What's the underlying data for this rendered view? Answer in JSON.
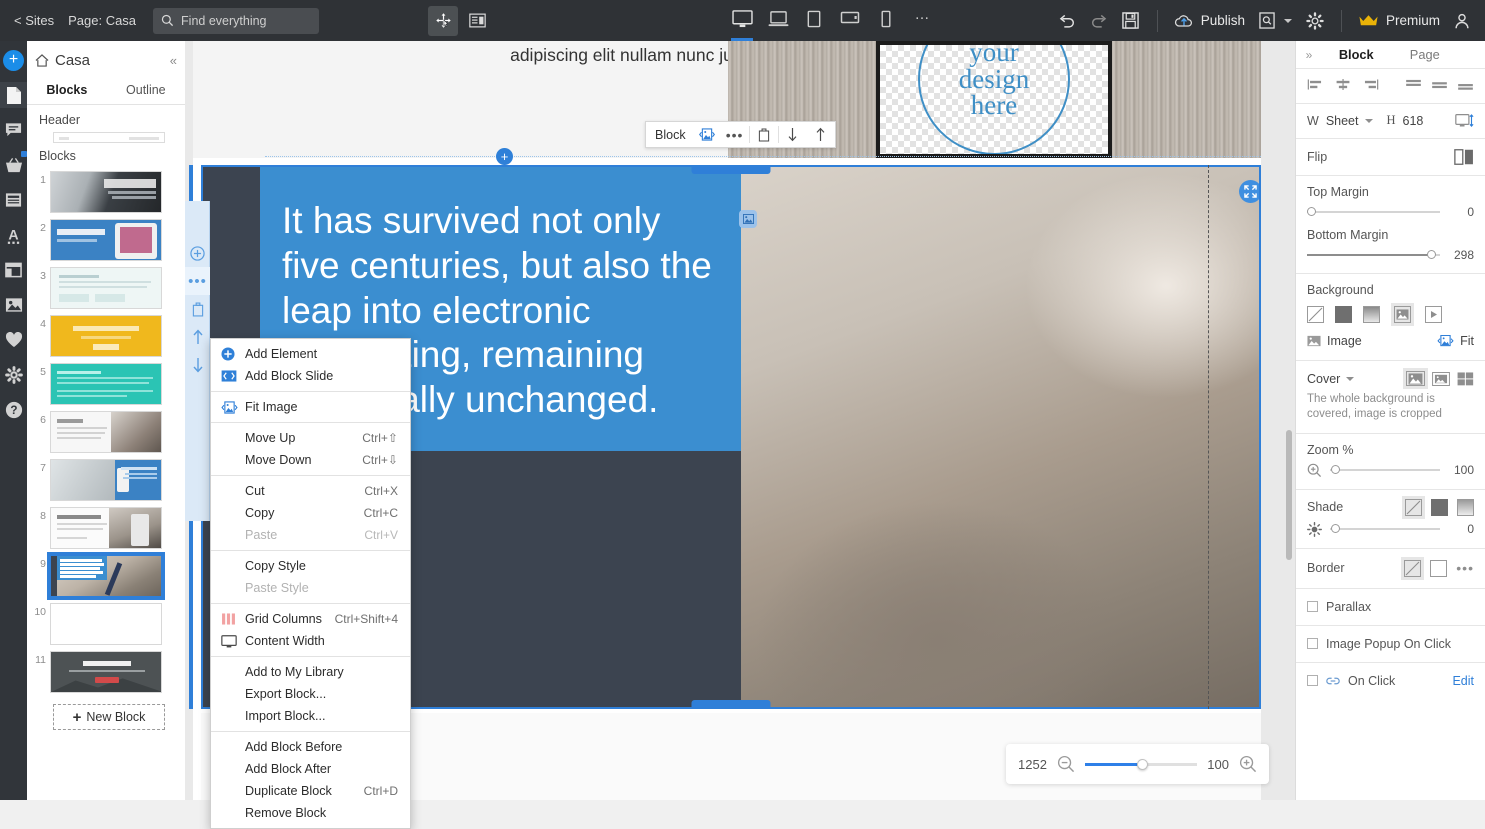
{
  "topbar": {
    "sites_link": "< Sites",
    "page_label": "Page: Casa",
    "search_placeholder": "Find everything",
    "move_tool_icon": "move-tool-icon",
    "layout_tool_icon": "layout-panel-icon",
    "devices": [
      {
        "name": "desktop",
        "selected": true
      },
      {
        "name": "laptop",
        "selected": false
      },
      {
        "name": "tablet-portrait",
        "selected": false
      },
      {
        "name": "tablet-landscape",
        "selected": false
      },
      {
        "name": "mobile",
        "selected": false
      }
    ],
    "more_devices": "…",
    "undo_icon": "undo-icon",
    "redo_icon": "redo-icon",
    "save_icon": "save-icon",
    "publish_label": "Publish",
    "preview_icon": "preview-page-icon",
    "settings_icon": "gear-icon",
    "premium_label": "Premium",
    "account_icon": "user-account-icon"
  },
  "rail": {
    "items": [
      {
        "name": "add",
        "icon": "plus-circle-icon"
      },
      {
        "name": "pages",
        "icon": "page-icon",
        "selected": true
      },
      {
        "name": "comments",
        "icon": "comment-icon"
      },
      {
        "name": "store",
        "icon": "shopping-basket-icon",
        "badge": true
      },
      {
        "name": "blocks",
        "icon": "blocks-icon"
      },
      {
        "name": "typography",
        "icon": "font-icon"
      },
      {
        "name": "layout",
        "icon": "layout-icon"
      },
      {
        "name": "images",
        "icon": "image-icon"
      },
      {
        "name": "favorites",
        "icon": "heart-icon"
      },
      {
        "name": "settings",
        "icon": "gear-icon"
      },
      {
        "name": "help",
        "icon": "question-icon"
      }
    ]
  },
  "panel": {
    "home_icon": "home-icon",
    "title": "Casa",
    "collapse_icon": "«",
    "tabs": [
      {
        "label": "Blocks",
        "selected": true
      },
      {
        "label": "Outline",
        "selected": false
      }
    ],
    "header_label": "Header",
    "blocks_label": "Blocks",
    "new_block_label": "New Block",
    "thumbs": [
      {
        "num": "1",
        "selected": false
      },
      {
        "num": "2",
        "selected": false
      },
      {
        "num": "3",
        "selected": false
      },
      {
        "num": "4",
        "selected": false
      },
      {
        "num": "5",
        "selected": false
      },
      {
        "num": "6",
        "selected": false
      },
      {
        "num": "7",
        "selected": false
      },
      {
        "num": "8",
        "selected": false
      },
      {
        "num": "9",
        "selected": true
      },
      {
        "num": "10",
        "selected": false
      },
      {
        "num": "11",
        "selected": false
      }
    ],
    "thumb_texts": {
      "t1": "Building bulletproof apps",
      "t6": "Beautifully",
      "t8": "See our awesome photos",
      "t9": "It has survived not only five centuries, but also the leap into electronic typesetting, remaining essentially unchanged.",
      "t11": "INTUITIVE"
    }
  },
  "canvas": {
    "above_block_text": "adipiscing elit nullam nunc justo sagittis suscipit ultrices.",
    "tablet_design_text": [
      "your",
      "design",
      "here"
    ],
    "selected_block_text": "It has survived not only five centuries, but also the leap into electronic typesetting, remaining essentially unchanged.",
    "insert_plus_icon": "add-block-icon",
    "image_badge_icon": "image-badge-icon",
    "fit_badge_icon": "fit-image-icon",
    "mini_rail": [
      {
        "name": "add-element",
        "icon": "plus-circle-icon"
      },
      {
        "name": "more-options",
        "icon": "ellipsis-icon"
      },
      {
        "name": "delete-block",
        "icon": "trash-icon"
      },
      {
        "name": "move-block-up",
        "icon": "arrow-up-icon"
      },
      {
        "name": "move-block-down",
        "icon": "arrow-down-icon"
      }
    ],
    "block_toolbar": {
      "label": "Block",
      "fit_icon": "fit-image-icon",
      "more_icon": "ellipsis-icon",
      "delete_icon": "trash-icon",
      "down_icon": "arrow-down-icon",
      "up_icon": "arrow-up-icon"
    }
  },
  "context_menu": {
    "groups": [
      [
        {
          "label": "Add Element",
          "key": "",
          "icon": "plus-circle-icon",
          "disabled": false,
          "indent": false
        },
        {
          "label": "Add Block Slide",
          "key": "",
          "icon": "slide-arrows-icon",
          "disabled": false,
          "indent": false
        }
      ],
      [
        {
          "label": "Fit Image",
          "key": "",
          "icon": "fit-image-icon",
          "disabled": false,
          "indent": false
        }
      ],
      [
        {
          "label": "Move Up",
          "key": "Ctrl+⇧",
          "icon": "",
          "disabled": false,
          "indent": true
        },
        {
          "label": "Move Down",
          "key": "Ctrl+⇩",
          "icon": "",
          "disabled": false,
          "indent": true
        }
      ],
      [
        {
          "label": "Cut",
          "key": "Ctrl+X",
          "icon": "",
          "disabled": false,
          "indent": true
        },
        {
          "label": "Copy",
          "key": "Ctrl+C",
          "icon": "",
          "disabled": false,
          "indent": true
        },
        {
          "label": "Paste",
          "key": "Ctrl+V",
          "icon": "",
          "disabled": true,
          "indent": true
        }
      ],
      [
        {
          "label": "Copy Style",
          "key": "",
          "icon": "",
          "disabled": false,
          "indent": true
        },
        {
          "label": "Paste Style",
          "key": "",
          "icon": "",
          "disabled": true,
          "indent": true
        }
      ],
      [
        {
          "label": "Grid Columns",
          "key": "Ctrl+Shift+4",
          "icon": "grid-columns-icon",
          "disabled": false,
          "indent": false
        },
        {
          "label": "Content Width",
          "key": "",
          "icon": "monitor-icon",
          "disabled": false,
          "indent": false
        }
      ],
      [
        {
          "label": "Add to My Library",
          "key": "",
          "icon": "",
          "disabled": false,
          "indent": true
        },
        {
          "label": "Export Block...",
          "key": "",
          "icon": "",
          "disabled": false,
          "indent": true
        },
        {
          "label": "Import Block...",
          "key": "",
          "icon": "",
          "disabled": false,
          "indent": true
        }
      ],
      [
        {
          "label": "Add Block Before",
          "key": "",
          "icon": "",
          "disabled": false,
          "indent": true
        },
        {
          "label": "Add Block After",
          "key": "",
          "icon": "",
          "disabled": false,
          "indent": true
        },
        {
          "label": "Duplicate Block",
          "key": "Ctrl+D",
          "icon": "",
          "disabled": false,
          "indent": true
        },
        {
          "label": "Remove Block",
          "key": "",
          "icon": "",
          "disabled": false,
          "indent": true
        }
      ]
    ]
  },
  "right_panel": {
    "expand_icon": "»",
    "tabs": [
      {
        "label": "Block",
        "selected": true
      },
      {
        "label": "Page",
        "selected": false
      }
    ],
    "size_row": {
      "w_label": "W",
      "width_value": "Sheet",
      "h_label": "H",
      "height_value": "618",
      "fullscreen_icon": "fit-screen-height-icon"
    },
    "flip_label": "Flip",
    "top_margin": {
      "label": "Top Margin",
      "value": "0",
      "percent": 0
    },
    "bottom_margin": {
      "label": "Bottom Margin",
      "value": "298",
      "percent": 92
    },
    "background": {
      "label": "Background",
      "options": [
        "none",
        "solid",
        "gradient",
        "image",
        "video"
      ],
      "selected_index": 3,
      "image_label": "Image",
      "fit_label": "Fit"
    },
    "cover": {
      "mode": "Cover",
      "hint": "The whole background is covered, image is cropped",
      "selected_index": 0
    },
    "zoom": {
      "label": "Zoom %",
      "value": "100",
      "percent": 4
    },
    "shade": {
      "label": "Shade",
      "value": "0",
      "percent": 4,
      "selected_index": 0
    },
    "border": {
      "label": "Border",
      "selected_index": 0,
      "more_icon": "ellipsis-icon"
    },
    "parallax": {
      "label": "Parallax",
      "checked": false
    },
    "image_popup": {
      "label": "Image Popup On Click",
      "checked": false
    },
    "on_click": {
      "label": "On Click",
      "checked": false,
      "edit_label": "Edit",
      "link_icon": "link-icon"
    }
  },
  "zoombar": {
    "width_value": "1252",
    "zoom_out_icon": "zoom-out-icon",
    "zoom_in_icon": "zoom-in-icon",
    "zoom_value": "100"
  },
  "colors": {
    "accent": "#2f7fd8",
    "topbar_bg": "#2f3236",
    "block_blue": "#3b8ed0",
    "premium_gold": "#eab308"
  }
}
